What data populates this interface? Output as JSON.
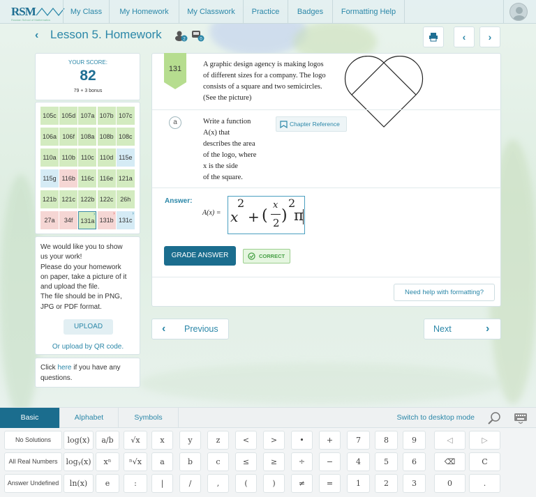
{
  "nav": {
    "logo_text": "RSM",
    "logo_sub": "Russian School of Mathematics",
    "items": [
      "My Class",
      "My Homework",
      "My Classwork",
      "Practice",
      "Badges",
      "Formatting Help"
    ]
  },
  "header": {
    "title": "Lesson 5. Homework",
    "icon_badges": [
      "2",
      "0"
    ]
  },
  "score": {
    "label": "YOUR SCORE:",
    "value": "82",
    "bonus": "79 + 3 bonus"
  },
  "problems_grid": [
    [
      "105c",
      "105d",
      "107a",
      "107b",
      "107c"
    ],
    [
      "106a",
      "106f",
      "108a",
      "108b",
      "108c"
    ],
    [
      "110a",
      "110b",
      "110c",
      "110d",
      "115e"
    ],
    [
      "115g",
      "116b",
      "116c",
      "116e",
      "121a"
    ],
    [
      "121b",
      "121c",
      "122b",
      "122c",
      "26h"
    ],
    [
      "27a",
      "34f",
      "131a",
      "131b",
      "131c"
    ]
  ],
  "homework_upload": {
    "text_lines": [
      "We would like you to show",
      "us your work!",
      "Please do your homework",
      "on paper, take a picture of it",
      "and upload the file.",
      "The file should be in PNG,",
      "JPG or PDF format."
    ],
    "upload_label": "UPLOAD",
    "qr_label": "Or upload by QR code."
  },
  "questions": {
    "prefix": "Click ",
    "link": "here",
    "suffix": " if you have any questions."
  },
  "problem": {
    "number": "131",
    "text_lines": [
      "A graphic design agency is making logos",
      "of different sizes for a company. The logo",
      "consists of a square and two semicircles.",
      "(See the picture)"
    ],
    "part_label": "a",
    "part_text_lines": [
      "Write a function",
      "A(x) that",
      "describes the area",
      "of the logo, where",
      "x is the side",
      "of the square."
    ],
    "chapter_ref": "Chapter Reference",
    "answer_label": "Answer:",
    "answer_prefix": "A(x) =",
    "answer": {
      "base": "x",
      "exp": "2",
      "plus": "+",
      "open": "(",
      "frac_num": "x",
      "frac_den": "2",
      "close": ")",
      "exp2": "2",
      "pi": "π"
    },
    "grade_label": "GRADE ANSWER",
    "correct_label": "CORRECT",
    "help_label": "Need help with formatting?"
  },
  "pager": {
    "previous": "Previous",
    "next": "Next"
  },
  "keyboard": {
    "tabs": [
      "Basic",
      "Alphabet",
      "Symbols"
    ],
    "switch_label": "Switch to desktop mode",
    "row1": [
      "No Solutions",
      "log(x)",
      "a/b",
      "√x",
      "x",
      "y",
      "z",
      "<",
      ">",
      "•",
      "+",
      "7",
      "8",
      "9",
      "◁",
      "▷"
    ],
    "row2": [
      "All Real Numbers",
      "logᵧ(x)",
      "xⁿ",
      "ⁿ√x",
      "a",
      "b",
      "c",
      "≤",
      "≥",
      "÷",
      "−",
      "4",
      "5",
      "6",
      "⌫",
      "C"
    ],
    "row3": [
      "Answer Undefined",
      "ln(x)",
      "e",
      ":",
      "|",
      "/",
      ",",
      "(",
      ")",
      "≠",
      "=",
      "1",
      "2",
      "3",
      "0",
      "."
    ]
  },
  "colors": {
    "brand": "#2b87a8",
    "dark_brand": "#1b6d8e",
    "correct": "#46a045"
  }
}
